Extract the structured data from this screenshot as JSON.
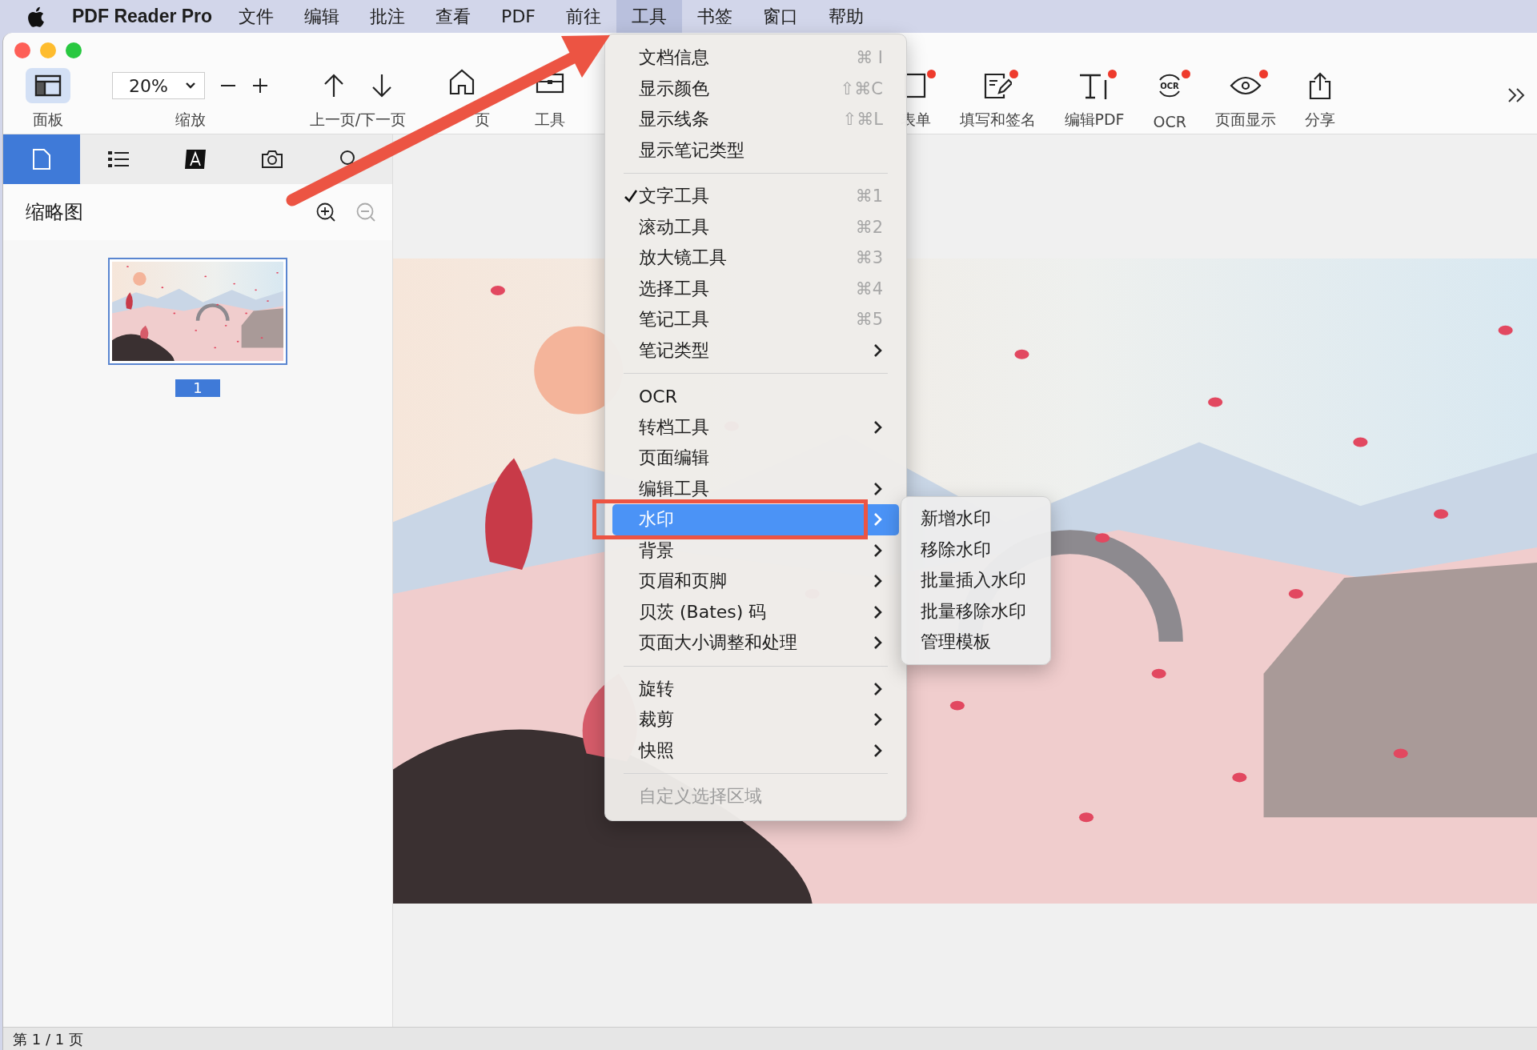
{
  "menu_bar": {
    "app_name": "PDF Reader Pro",
    "menus": [
      {
        "label": "文件",
        "selected": false
      },
      {
        "label": "编辑",
        "selected": false
      },
      {
        "label": "批注",
        "selected": false
      },
      {
        "label": "查看",
        "selected": false
      },
      {
        "label": "PDF",
        "selected": false
      },
      {
        "label": "前往",
        "selected": false
      },
      {
        "label": "工具",
        "selected": true
      },
      {
        "label": "书签",
        "selected": false
      },
      {
        "label": "窗口",
        "selected": false
      },
      {
        "label": "帮助",
        "selected": false
      }
    ]
  },
  "toolbar": {
    "zoom_value": "20%",
    "left_items": [
      {
        "kind": "panel",
        "label": "面板",
        "selected": true
      },
      {
        "kind": "zoom",
        "label": "缩放"
      },
      {
        "kind": "nav",
        "label": "上一页/下一页"
      },
      {
        "kind": "home",
        "label": "页"
      },
      {
        "kind": "tools",
        "label": "工具"
      }
    ],
    "right_items": [
      {
        "kind": "form",
        "label": "表单",
        "badge": true
      },
      {
        "kind": "sign",
        "label": "填写和签名",
        "badge": true
      },
      {
        "kind": "edit",
        "label": "编辑PDF",
        "badge": true
      },
      {
        "kind": "ocr",
        "label": "OCR",
        "badge": true,
        "icon_text": "OCR"
      },
      {
        "kind": "view",
        "label": "页面显示",
        "badge": true
      },
      {
        "kind": "share",
        "label": "分享"
      }
    ]
  },
  "sidebar": {
    "tabs": [
      {
        "kind": "page",
        "selected": true
      },
      {
        "kind": "list",
        "selected": false
      },
      {
        "kind": "text",
        "selected": false
      },
      {
        "kind": "camera",
        "selected": false
      },
      {
        "kind": "search",
        "selected": false
      }
    ],
    "title": "缩略图",
    "zoom_in_disabled": false,
    "zoom_out_disabled": true,
    "thumbnails": [
      {
        "page": "1",
        "selected": true
      }
    ]
  },
  "document": {
    "kind": "picture"
  },
  "tools_menu": [
    {
      "kind": "item",
      "label": "文档信息",
      "shortcut": "⌘ I",
      "checked": false,
      "submenu": false,
      "disabled": false,
      "selected": false
    },
    {
      "kind": "item",
      "label": "显示颜色",
      "shortcut": "⇧⌘C",
      "checked": false,
      "submenu": false,
      "disabled": false,
      "selected": false
    },
    {
      "kind": "item",
      "label": "显示线条",
      "shortcut": "⇧⌘L",
      "checked": false,
      "submenu": false,
      "disabled": false,
      "selected": false
    },
    {
      "kind": "item",
      "label": "显示笔记类型",
      "checked": false,
      "submenu": false,
      "disabled": false,
      "selected": false
    },
    {
      "kind": "separator"
    },
    {
      "kind": "item",
      "label": "文字工具",
      "shortcut": "⌘1",
      "checked": true,
      "submenu": false,
      "disabled": false,
      "selected": false
    },
    {
      "kind": "item",
      "label": "滚动工具",
      "shortcut": "⌘2",
      "checked": false,
      "submenu": false,
      "disabled": false,
      "selected": false
    },
    {
      "kind": "item",
      "label": "放大镜工具",
      "shortcut": "⌘3",
      "checked": false,
      "submenu": false,
      "disabled": false,
      "selected": false
    },
    {
      "kind": "item",
      "label": "选择工具",
      "shortcut": "⌘4",
      "checked": false,
      "submenu": false,
      "disabled": false,
      "selected": false
    },
    {
      "kind": "item",
      "label": "笔记工具",
      "shortcut": "⌘5",
      "checked": false,
      "submenu": false,
      "disabled": false,
      "selected": false
    },
    {
      "kind": "item",
      "label": "笔记类型",
      "checked": false,
      "submenu": true,
      "disabled": false,
      "selected": false
    },
    {
      "kind": "separator"
    },
    {
      "kind": "item",
      "label": "OCR",
      "checked": false,
      "submenu": false,
      "disabled": false,
      "selected": false
    },
    {
      "kind": "item",
      "label": "转档工具",
      "checked": false,
      "submenu": true,
      "disabled": false,
      "selected": false
    },
    {
      "kind": "item",
      "label": "页面编辑",
      "checked": false,
      "submenu": false,
      "disabled": false,
      "selected": false
    },
    {
      "kind": "item",
      "label": "编辑工具",
      "checked": false,
      "submenu": true,
      "disabled": false,
      "selected": false
    },
    {
      "kind": "item",
      "label": "水印",
      "checked": false,
      "submenu": true,
      "disabled": false,
      "selected": true
    },
    {
      "kind": "item",
      "label": "背景",
      "checked": false,
      "submenu": true,
      "disabled": false,
      "selected": false
    },
    {
      "kind": "item",
      "label": "页眉和页脚",
      "checked": false,
      "submenu": true,
      "disabled": false,
      "selected": false
    },
    {
      "kind": "item",
      "label": "贝茨 (Bates) 码",
      "checked": false,
      "submenu": true,
      "disabled": false,
      "selected": false
    },
    {
      "kind": "item",
      "label": "页面大小调整和处理",
      "checked": false,
      "submenu": true,
      "disabled": false,
      "selected": false
    },
    {
      "kind": "separator"
    },
    {
      "kind": "item",
      "label": "旋转",
      "checked": false,
      "submenu": true,
      "disabled": false,
      "selected": false
    },
    {
      "kind": "item",
      "label": "裁剪",
      "checked": false,
      "submenu": true,
      "disabled": false,
      "selected": false
    },
    {
      "kind": "item",
      "label": "快照",
      "checked": false,
      "submenu": true,
      "disabled": false,
      "selected": false
    },
    {
      "kind": "separator"
    },
    {
      "kind": "item",
      "label": "自定义选择区域",
      "checked": false,
      "submenu": false,
      "disabled": true,
      "selected": false
    }
  ],
  "watermark_submenu": [
    "新增水印",
    "移除水印",
    "批量插入水印",
    "批量移除水印",
    "管理模板"
  ],
  "status_bar": {
    "page_info": "第 1 / 1 页"
  }
}
